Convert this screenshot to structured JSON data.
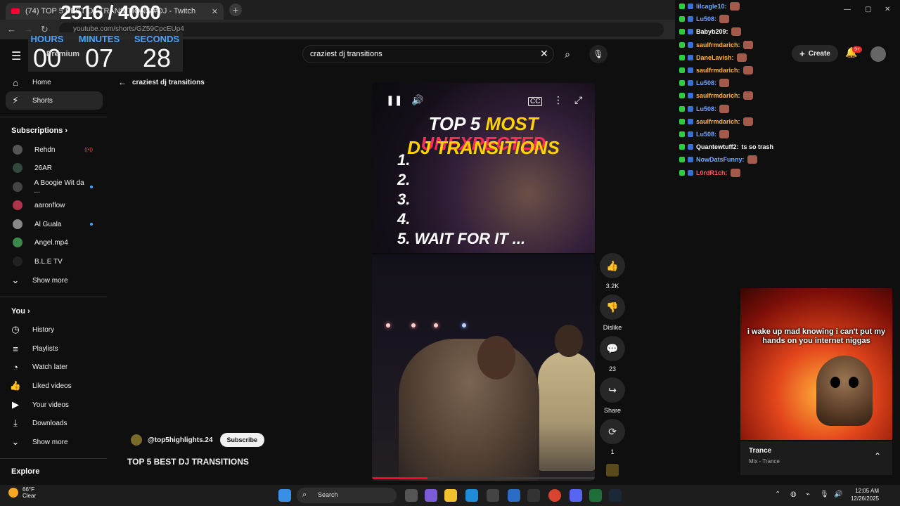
{
  "browser": {
    "tab_title": "(74) TOP 5 BEST DJ TRANSITIONS #DJ - Twitch",
    "url": "youtube.com/shorts/GZ59CpcEUp4"
  },
  "overlay": {
    "count": "2516 / 4000",
    "hours_label": "HOURS",
    "minutes_label": "MINUTES",
    "seconds_label": "SECONDS",
    "hours": "00",
    "minutes": "07",
    "seconds": "28",
    "premium_text": "Premium"
  },
  "search": {
    "query": "craziest dj transitions"
  },
  "header": {
    "create_label": "Create",
    "notifications_badge": "9+"
  },
  "sidebar": {
    "home": "Home",
    "shorts": "Shorts",
    "subscriptions_title": "Subscriptions",
    "subscriptions": [
      {
        "name": "Rehdn",
        "live": true
      },
      {
        "name": "26AR",
        "dot": false
      },
      {
        "name": "A Boogie Wit da ...",
        "dot": true
      },
      {
        "name": "aaronflow",
        "dot": false
      },
      {
        "name": "Al Guala",
        "dot": true
      },
      {
        "name": "Angel.mp4",
        "dot": false
      },
      {
        "name": "B.L.E TV",
        "dot": false
      }
    ],
    "show_more_1": "Show more",
    "you_title": "You",
    "you_items": [
      "History",
      "Playlists",
      "Watch later",
      "Liked videos",
      "Your videos",
      "Downloads"
    ],
    "show_more_2": "Show more",
    "explore": "Explore"
  },
  "back": {
    "label": "craziest dj transitions"
  },
  "video": {
    "title_line1_a": "TOP 5 ",
    "title_line1_b": "MOST ",
    "title_line1_c": "UNEXPECTED",
    "title_line2": "DJ TRANSITIONS",
    "list": [
      "1.",
      "2.",
      "3.",
      "4.",
      "5. WAIT FOR IT ..."
    ],
    "progress": 0.25
  },
  "actions": {
    "likes": "3.2K",
    "dislike": "Dislike",
    "comments": "23",
    "share": "Share",
    "remix": "1"
  },
  "channel": {
    "handle": "@top5highlights.24",
    "subscribe": "Subscribe",
    "video_title": "TOP 5 BEST DJ TRANSITIONS"
  },
  "chat": [
    {
      "user": "lilcagle10:",
      "color": "#6fa8ff",
      "emote": true
    },
    {
      "user": "Lu508:",
      "color": "#6fa8ff",
      "emote": true
    },
    {
      "user": "Babyb209:",
      "color": "#ffffff",
      "emote": true
    },
    {
      "user": "saulfrmdarich:",
      "color": "#ffb347",
      "emote": true
    },
    {
      "user": "DaneLavish:",
      "color": "#ffb347",
      "emote": true
    },
    {
      "user": "saulfrmdarich:",
      "color": "#ffb347",
      "emote": true
    },
    {
      "user": "Lu508:",
      "color": "#6fa8ff",
      "emote": true
    },
    {
      "user": "saulfrmdarich:",
      "color": "#ffb347",
      "emote": true
    },
    {
      "user": "Lu508:",
      "color": "#6fa8ff",
      "emote": true
    },
    {
      "user": "saulfrmdarich:",
      "color": "#ffb347",
      "emote": true
    },
    {
      "user": "Lu508:",
      "color": "#6fa8ff",
      "emote": true
    },
    {
      "user": "Quantewtuff2:",
      "color": "#ffffff",
      "message": "ts so trash",
      "emote": false
    },
    {
      "user": "NowDatsFunny:",
      "color": "#6fa8ff",
      "emote": true
    },
    {
      "user": "L0rdR1ch:",
      "color": "#ff5a5a",
      "emote": true
    }
  ],
  "meme": {
    "caption": "i wake up mad knowing i can't put my hands on you internet niggas"
  },
  "music": {
    "title": "Trance",
    "subtitle": "Mix - Trance"
  },
  "taskbar": {
    "temp": "66°F",
    "condition": "Clear",
    "search_label": "Search",
    "time": "12:05 AM",
    "date": "12/26/2025"
  }
}
